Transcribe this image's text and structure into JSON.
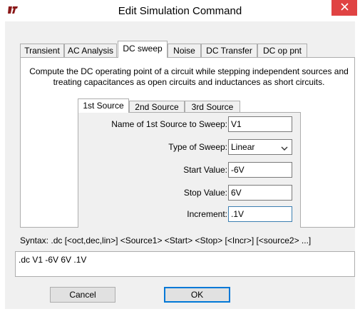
{
  "window": {
    "title": "Edit Simulation Command",
    "close_icon": "close-icon",
    "logo_icon": "ltspice-logo-icon"
  },
  "tabs": [
    {
      "label": "Transient",
      "active": false
    },
    {
      "label": "AC Analysis",
      "active": false
    },
    {
      "label": "DC sweep",
      "active": true
    },
    {
      "label": "Noise",
      "active": false
    },
    {
      "label": "DC Transfer",
      "active": false
    },
    {
      "label": "DC op pnt",
      "active": false
    }
  ],
  "description_line1": "Compute the DC operating point of a circuit while stepping independent sources and",
  "description_line2": "treating capacitances as open circuits and inductances as short circuits.",
  "source_tabs": [
    {
      "label": "1st Source",
      "active": true
    },
    {
      "label": "2nd Source",
      "active": false
    },
    {
      "label": "3rd Source",
      "active": false
    }
  ],
  "fields": {
    "source_name": {
      "label": "Name of 1st Source to Sweep:",
      "value": "V1"
    },
    "sweep_type": {
      "label": "Type of Sweep:",
      "value": "Linear"
    },
    "start": {
      "label": "Start Value:",
      "value": "-6V"
    },
    "stop": {
      "label": "Stop Value:",
      "value": "6V"
    },
    "increment": {
      "label": "Increment:",
      "value": ".1V"
    }
  },
  "syntax": "Syntax:  .dc [<oct,dec,lin>] <Source1> <Start> <Stop> [<Incr>] [<source2> ...]",
  "command": ".dc V1 -6V 6V .1V",
  "buttons": {
    "cancel": "Cancel",
    "ok": "OK"
  },
  "colors": {
    "close_button": "#e04343",
    "dialog_bg": "#f0f0f0",
    "focus_border": "#3c7fb1",
    "default_button_border": "#0078d7"
  }
}
